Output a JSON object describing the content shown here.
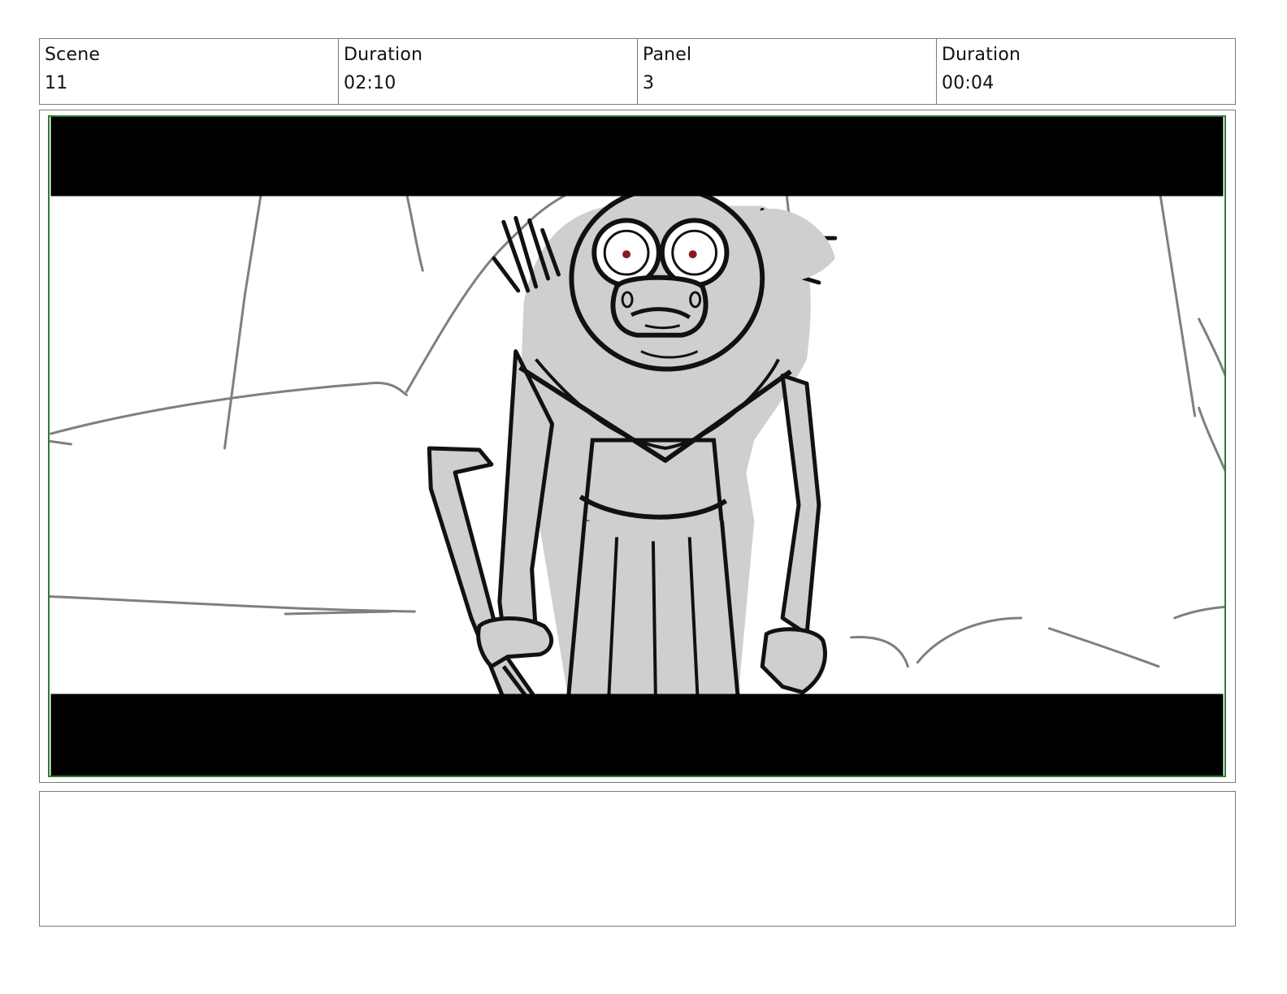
{
  "header": {
    "scene_label": "Scene",
    "scene_value": "11",
    "scene_duration_label": "Duration",
    "scene_duration_value": "02:10",
    "panel_label": "Panel",
    "panel_value": "3",
    "panel_duration_label": "Duration",
    "panel_duration_value": "00:04"
  },
  "panel": {
    "frame_border_color": "#2e7d32",
    "letterbox_color": "#000000",
    "figure_fill_color": "#cfcfcf"
  },
  "notes": {
    "text": ""
  }
}
